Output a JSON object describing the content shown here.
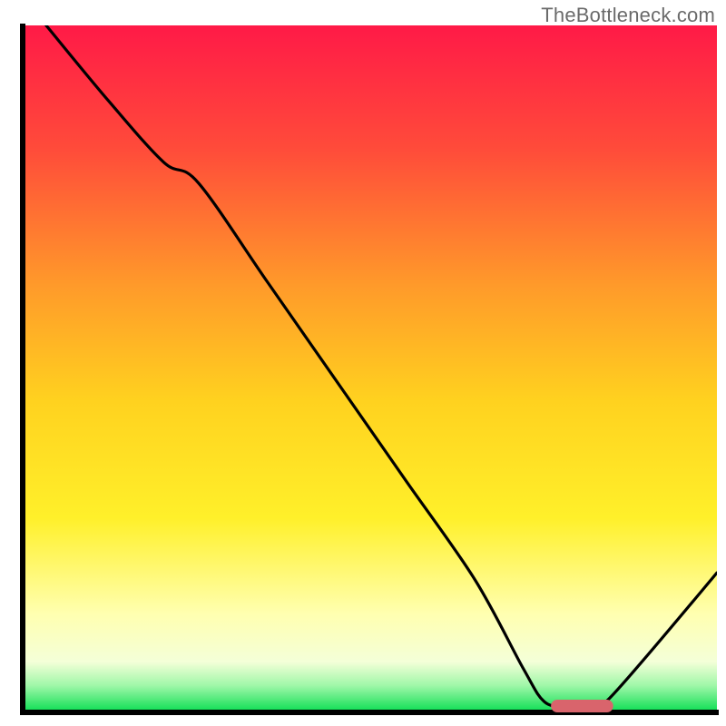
{
  "watermark": "TheBottleneck.com",
  "chart_data": {
    "type": "line",
    "title": "",
    "xlabel": "",
    "ylabel": "",
    "xlim": [
      0,
      100
    ],
    "ylim": [
      0,
      100
    ],
    "series": [
      {
        "name": "curve",
        "description": "Black curve showing a value that starts at y=100 at x≈3, descends with a slight bend near x≈25 (y≈77), continues near-linearly down to a flat minimum y≈0 over x≈75–84, then rises back up to y≈20 at x=100.",
        "points": [
          {
            "x": 3,
            "y": 100
          },
          {
            "x": 12,
            "y": 89
          },
          {
            "x": 20,
            "y": 80
          },
          {
            "x": 25,
            "y": 77
          },
          {
            "x": 35,
            "y": 62.5
          },
          {
            "x": 45,
            "y": 48
          },
          {
            "x": 55,
            "y": 33.5
          },
          {
            "x": 65,
            "y": 19
          },
          {
            "x": 72,
            "y": 6
          },
          {
            "x": 75,
            "y": 1.2
          },
          {
            "x": 78,
            "y": 0.5
          },
          {
            "x": 82,
            "y": 0.5
          },
          {
            "x": 84,
            "y": 1.2
          },
          {
            "x": 90,
            "y": 8
          },
          {
            "x": 100,
            "y": 20
          }
        ]
      }
    ],
    "marker": {
      "description": "Rounded red-pink bar on the baseline marking the flat-minimum region",
      "x_start": 76,
      "x_end": 85,
      "thickness_px": 14,
      "color": "#d9646c"
    },
    "background_gradient": {
      "description": "Vertical gradient inside plot: red top -> orange -> yellow -> pale yellow -> green bottom",
      "stops": [
        {
          "offset": 0.0,
          "color": "#ff1a47"
        },
        {
          "offset": 0.18,
          "color": "#ff4b3a"
        },
        {
          "offset": 0.38,
          "color": "#ff9a2a"
        },
        {
          "offset": 0.55,
          "color": "#ffd21f"
        },
        {
          "offset": 0.72,
          "color": "#fff02a"
        },
        {
          "offset": 0.86,
          "color": "#ffffb0"
        },
        {
          "offset": 0.93,
          "color": "#f4ffd8"
        },
        {
          "offset": 0.965,
          "color": "#9ff7a8"
        },
        {
          "offset": 1.0,
          "color": "#18e05a"
        }
      ]
    },
    "axes": {
      "frame": "L-shape: left and bottom edges only, black, ~6px",
      "ticks": "none visible",
      "grid": "none"
    }
  }
}
